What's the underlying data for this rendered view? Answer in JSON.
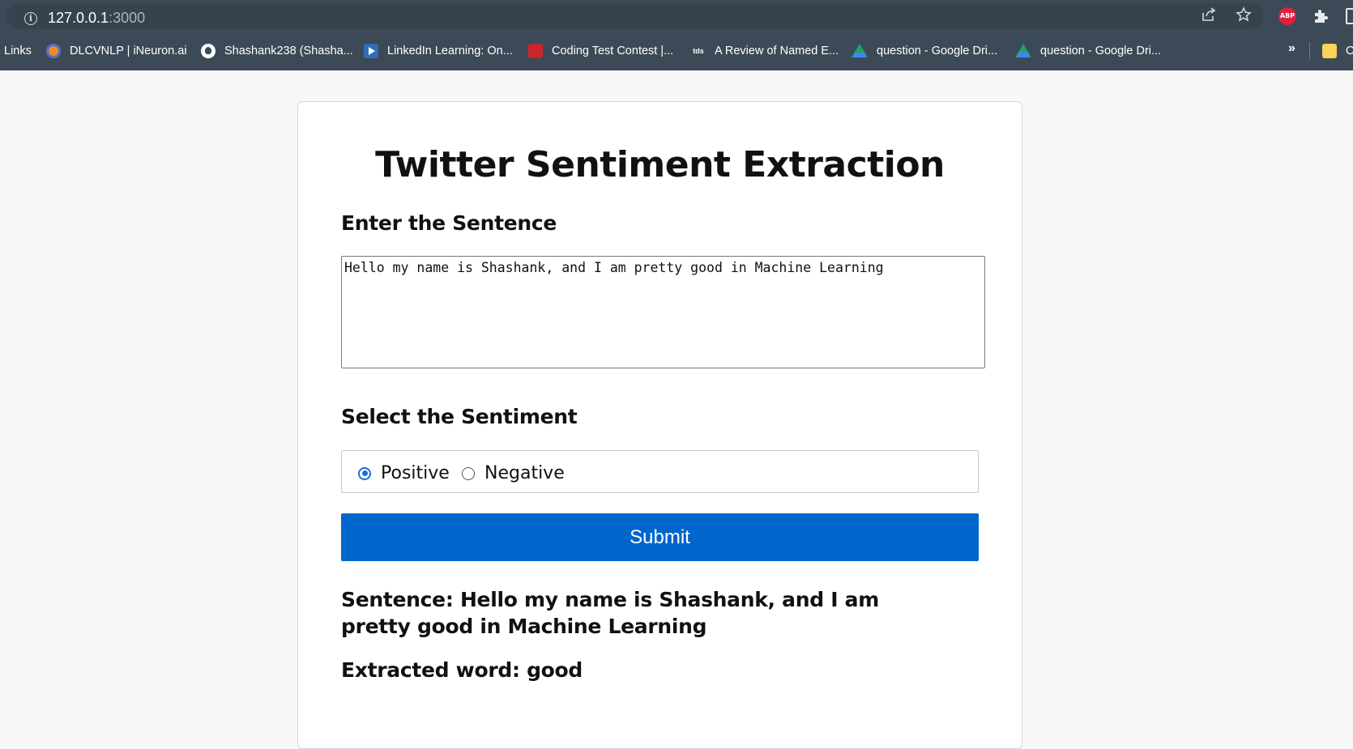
{
  "browser": {
    "url_host": "127.0.0.1",
    "url_port": ":3000",
    "abp_label": "ABP",
    "bookmarks": [
      {
        "label": "Links",
        "icon": "none"
      },
      {
        "label": "DLCVNLP | iNeuron.ai",
        "icon": "ineuron-icon"
      },
      {
        "label": "Shashank238 (Shasha...",
        "icon": "github-icon"
      },
      {
        "label": "LinkedIn Learning: On...",
        "icon": "linkedin-learning-icon"
      },
      {
        "label": "Coding Test Contest |...",
        "icon": "contest-icon"
      },
      {
        "label": "A Review of Named E...",
        "icon": "tds-icon"
      },
      {
        "label": "question - Google Dri...",
        "icon": "google-drive-icon"
      },
      {
        "label": "question - Google Dri...",
        "icon": "google-drive-icon"
      },
      {
        "label": "O",
        "icon": "folder-icon"
      }
    ],
    "tds_text": "tds",
    "more_label": "»"
  },
  "page": {
    "title": "Twitter Sentiment Extraction",
    "sentence_label": "Enter the Sentence",
    "sentence_value": "Hello my name is Shashank, and I am pretty good in Machine Learning",
    "sentiment_label": "Select the Sentiment",
    "options": [
      {
        "label": "Positive",
        "selected": true
      },
      {
        "label": "Negative",
        "selected": false
      }
    ],
    "submit_label": "Submit",
    "result_sentence": "Sentence: Hello my name is Shashank, and I am pretty good in Machine Learning",
    "result_word": "Extracted word: good"
  },
  "colors": {
    "accent": "#0066cc",
    "chrome": "#3b4a56"
  }
}
